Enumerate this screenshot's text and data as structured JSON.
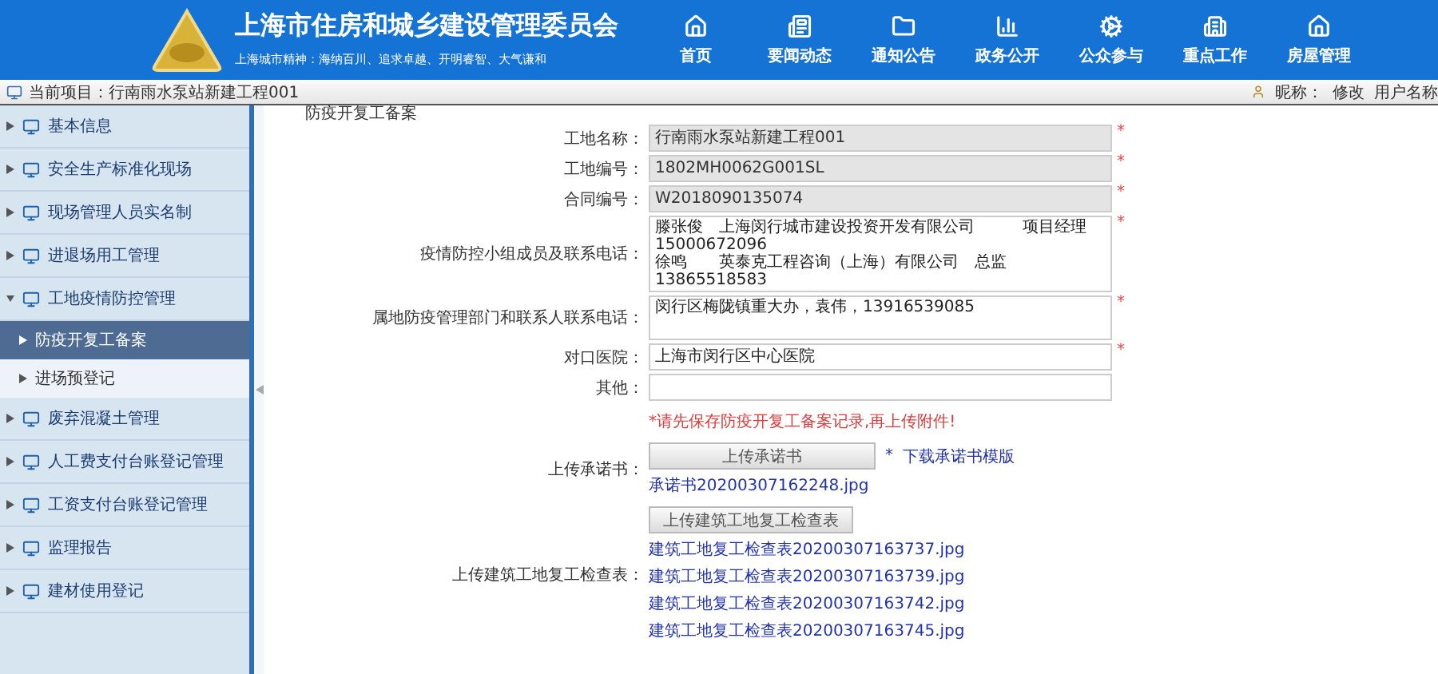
{
  "header": {
    "title": "上海市住房和城乡建设管理委员会",
    "slogan": "上海城市精神：海纳百川、追求卓越、开明睿智、大气谦和",
    "nav": [
      {
        "label": "首页",
        "kind": "home"
      },
      {
        "label": "要闻动态",
        "kind": "news"
      },
      {
        "label": "通知公告",
        "kind": "folder"
      },
      {
        "label": "政务公开",
        "kind": "chart"
      },
      {
        "label": "公众参与",
        "kind": "gear"
      },
      {
        "label": "重点工作",
        "kind": "building"
      },
      {
        "label": "房屋管理",
        "kind": "house"
      }
    ]
  },
  "subbar": {
    "current_project": "当前项目：行南雨水泵站新建工程001",
    "nickname_label": "昵称：",
    "edit_link": "修改",
    "username_label": "用户名称"
  },
  "sidebar": {
    "items": [
      {
        "label": "基本信息",
        "expanded": false
      },
      {
        "label": "安全生产标准化现场",
        "expanded": false
      },
      {
        "label": "现场管理人员实名制",
        "expanded": false
      },
      {
        "label": "进退场用工管理",
        "expanded": false
      },
      {
        "label": "工地疫情防控管理",
        "expanded": true,
        "children": [
          {
            "label": "防疫开复工备案",
            "selected": true
          },
          {
            "label": "进场预登记",
            "selected": false
          }
        ]
      },
      {
        "label": "废弃混凝土管理",
        "expanded": false
      },
      {
        "label": "人工费支付台账登记管理",
        "expanded": false
      },
      {
        "label": "工资支付台账登记管理",
        "expanded": false
      },
      {
        "label": "监理报告",
        "expanded": false
      },
      {
        "label": "建材使用登记",
        "expanded": false
      }
    ]
  },
  "page_title": "防疫开复工备案",
  "form": {
    "fields": [
      {
        "kind": "input",
        "label": "工地名称：",
        "value": "行南雨水泵站新建工程001",
        "readonly": true,
        "required": true
      },
      {
        "kind": "input",
        "label": "工地编号：",
        "value": "1802MH0062G001SL",
        "readonly": true,
        "required": true
      },
      {
        "kind": "input",
        "label": "合同编号：",
        "value": "W2018090135074",
        "readonly": true,
        "required": true
      },
      {
        "kind": "textarea",
        "label": "疫情防控小组成员及联系电话：",
        "lines": [
          "滕张俊　上海闵行城市建设投资开发有限公司　　　项目经理",
          "15000672096",
          "徐鸣　　英泰克工程咨询（上海）有限公司　总监　　13865518583"
        ],
        "readonly": false,
        "required": true
      },
      {
        "kind": "textarea",
        "label": "属地防疫管理部门和联系人联系电话：",
        "lines": [
          "闵行区梅陇镇重大办，袁伟，13916539085"
        ],
        "readonly": false,
        "required": true
      },
      {
        "kind": "input",
        "label": "对口医院：",
        "value": "上海市闵行区中心医院",
        "readonly": false,
        "required": true
      },
      {
        "kind": "input",
        "label": "其他：",
        "readonly": false,
        "required": false
      }
    ],
    "required_mark": "*",
    "notice": "*请先保存防疫开复工备案记录,再上传附件!",
    "uploads": [
      {
        "label": "上传承诺书：",
        "button": "上传承诺书",
        "template_link": "下载承诺书模版",
        "files": [
          "承诺书20200307162248.jpg"
        ]
      },
      {
        "label": "上传建筑工地复工检查表：",
        "button": "上传建筑工地复工检查表",
        "files": [
          "建筑工地复工检查表20200307163737.jpg",
          "建筑工地复工检查表20200307163739.jpg",
          "建筑工地复工检查表20200307163742.jpg",
          "建筑工地复工检查表20200307163745.jpg"
        ]
      }
    ]
  }
}
